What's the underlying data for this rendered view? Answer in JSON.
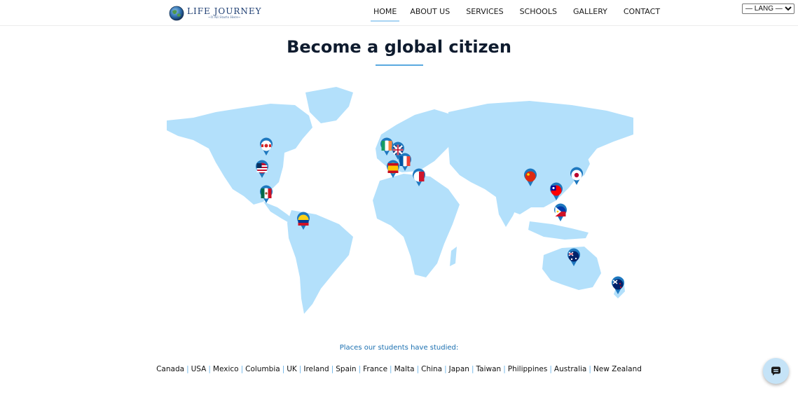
{
  "header": {
    "logo_title": "LIFE JOURNEY",
    "logo_tagline": "~It All Starts Here~",
    "nav": [
      {
        "label": "HOME",
        "active": true
      },
      {
        "label": "ABOUT US",
        "active": false
      },
      {
        "label": "SERVICES",
        "active": false
      },
      {
        "label": "SCHOOLS",
        "active": false
      },
      {
        "label": "GALLERY",
        "active": false
      },
      {
        "label": "CONTACT",
        "active": false
      }
    ],
    "lang_select": "— LANG —"
  },
  "main": {
    "title": "Become a global citizen",
    "places_label": "Places our students have studied:",
    "countries": [
      "Canada",
      "USA",
      "Mexico",
      "Columbia",
      "UK",
      "Ireland",
      "Spain",
      "France",
      "Malta",
      "China",
      "Japan",
      "Taiwan",
      "Philippines",
      "Australia",
      "New Zealand"
    ]
  },
  "colors": {
    "map_land": "#b3e0fb",
    "accent": "#5aa9e0",
    "pin_blue": "#1e78bf",
    "title": "#0e1b2e"
  },
  "icons": {
    "chat": "chat-icon",
    "globe": "globe-icon"
  }
}
